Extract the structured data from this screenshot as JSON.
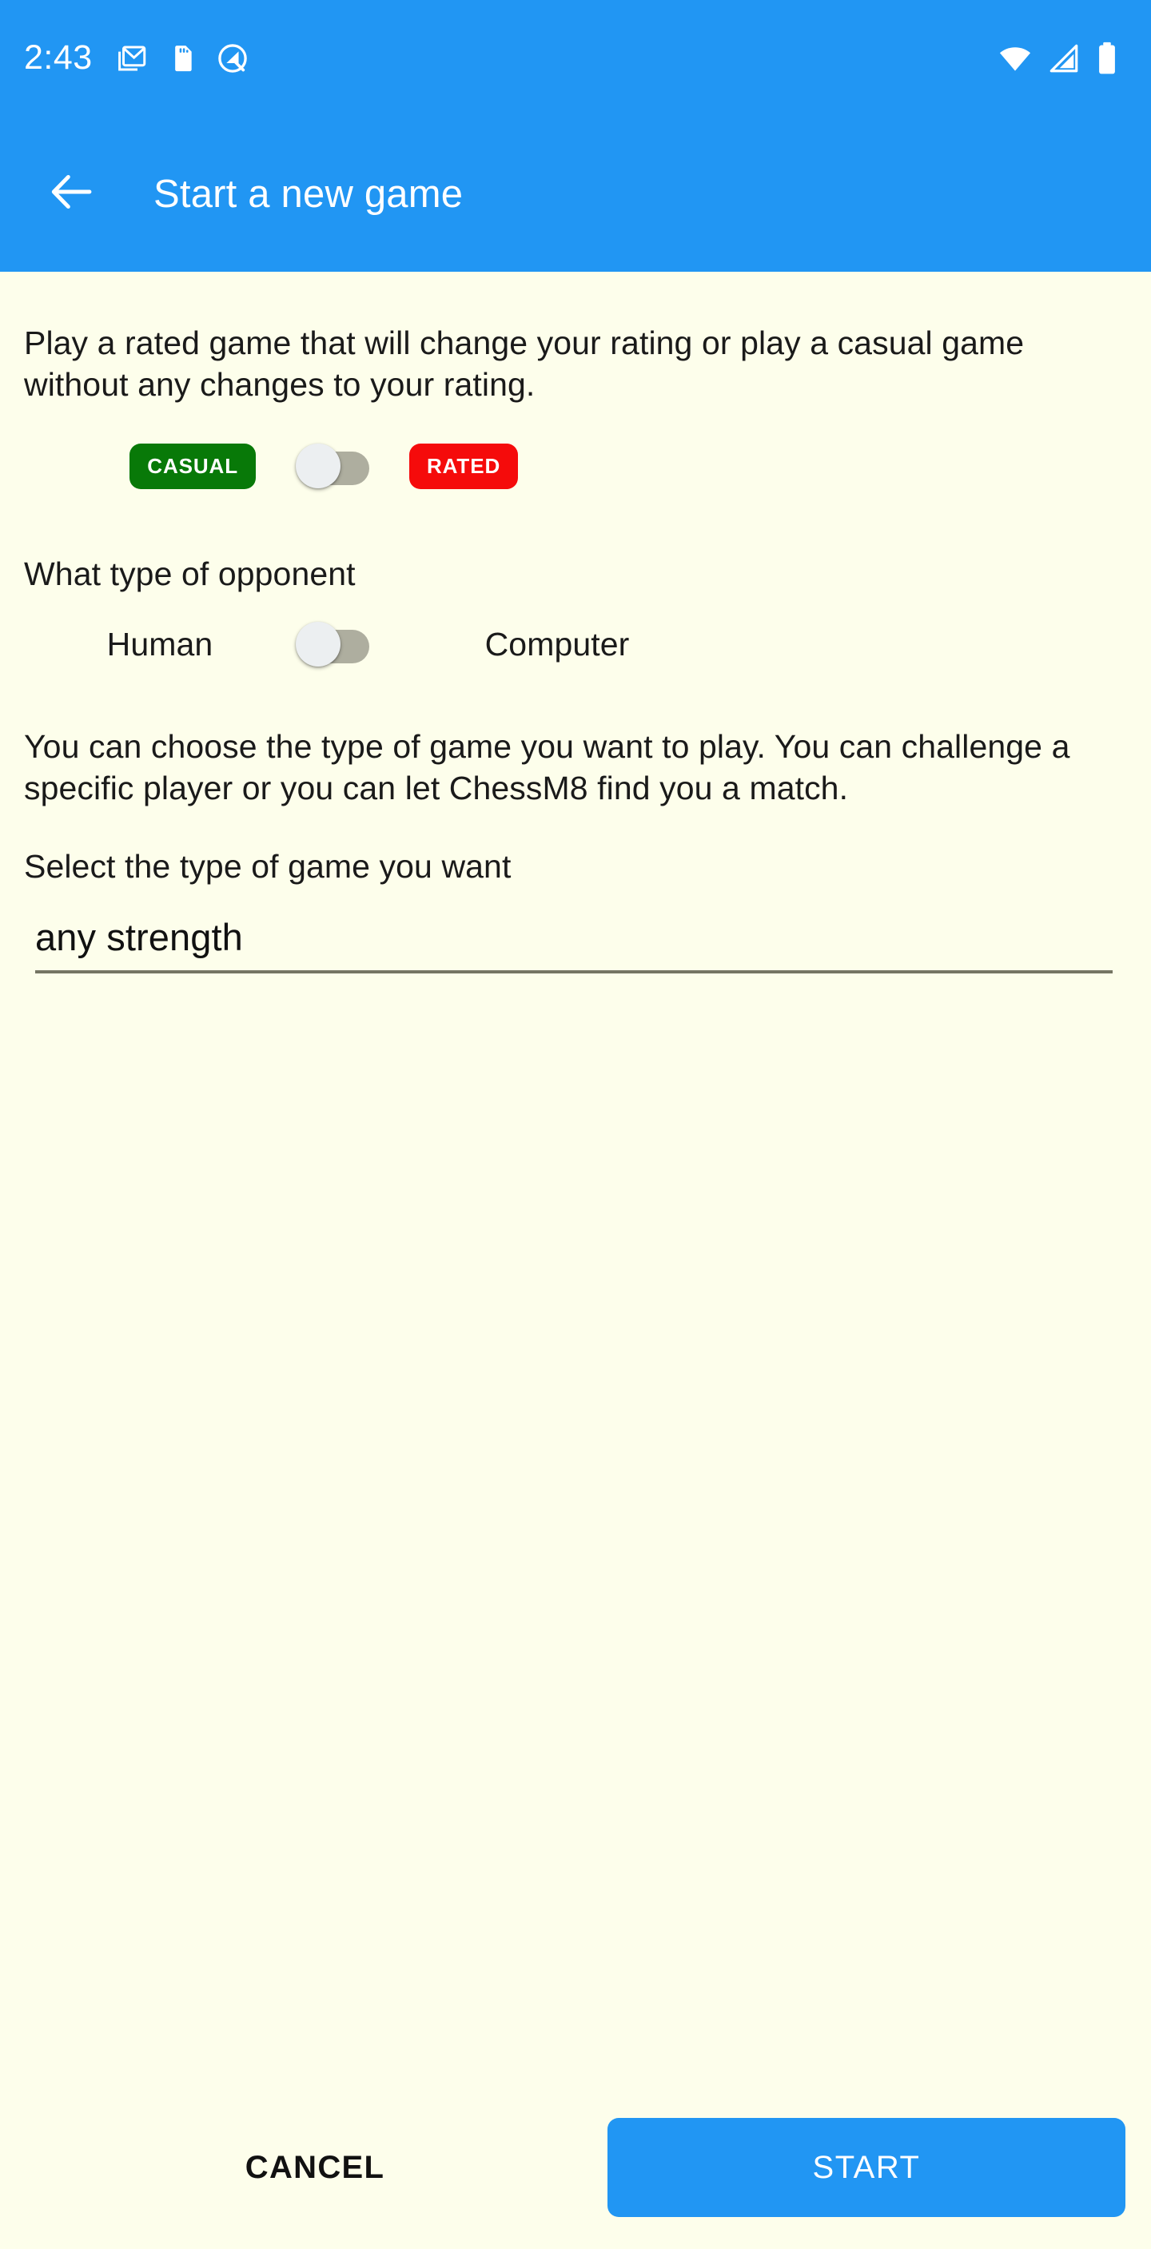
{
  "status_bar": {
    "time": "2:43",
    "left_icons": [
      {
        "name": "gmail-icon",
        "label": "Gmail"
      },
      {
        "name": "sd-card-icon",
        "label": "SD card"
      },
      {
        "name": "android-q-icon",
        "label": "Android system"
      }
    ],
    "right_icons": [
      {
        "name": "wifi-icon",
        "label": "Wi-Fi"
      },
      {
        "name": "cellular-signal-icon",
        "label": "Mobile signal"
      },
      {
        "name": "battery-icon",
        "label": "Battery"
      }
    ],
    "background_color": "#2196f3"
  },
  "app_bar": {
    "title": "Start a new game",
    "back_icon": "arrow-back-icon",
    "background_color": "#2196f3",
    "text_color": "#ffffff"
  },
  "content": {
    "rated_description": "Play a rated game that will change your rating or play a casual game without any changes to your rating.",
    "rated_toggle": {
      "left_label": "CASUAL",
      "right_label": "RATED",
      "left_color": "#087908",
      "right_color": "#f50b0b",
      "state": "off",
      "selected": "CASUAL"
    },
    "opponent_label": "What type of opponent",
    "opponent_toggle": {
      "left_label": "Human",
      "right_label": "Computer",
      "state": "off",
      "selected": "Human"
    },
    "choose_description": "You can choose the type of game you want to play. You can challenge a specific player or you can let ChessM8 find you a match.",
    "select_label": "Select the type of game you want",
    "game_type_select": {
      "value": "any strength",
      "placeholder": "any strength"
    }
  },
  "bottom_actions": {
    "cancel_label": "CANCEL",
    "start_label": "START",
    "start_color": "#2196f3"
  },
  "page": {
    "background_color": "#fdfeeb"
  }
}
